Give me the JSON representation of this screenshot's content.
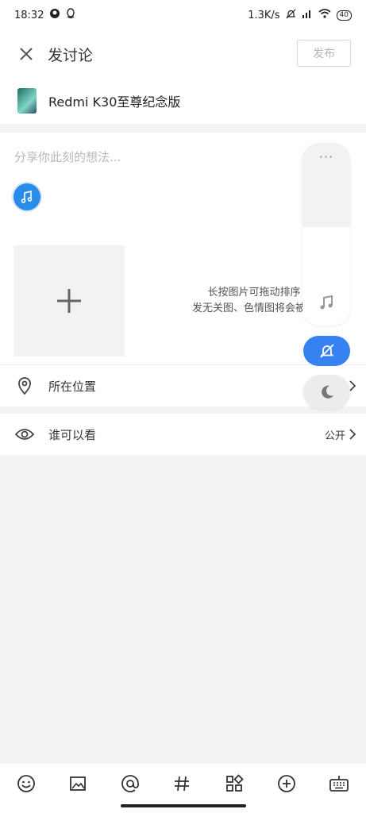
{
  "status_bar": {
    "time": "18:32",
    "network_speed": "1.3K/s",
    "battery": "40"
  },
  "header": {
    "title": "发讨论",
    "publish_label": "发布"
  },
  "device": {
    "name": "Redmi K30至尊纪念版"
  },
  "compose": {
    "placeholder": "分享你此刻的想法...",
    "hint_line1": "长按图片可拖动排序",
    "hint_line2": "发无关图、色情图将会被禁"
  },
  "location": {
    "label": "所在位置"
  },
  "visibility": {
    "label": "谁可以看",
    "value": "公开"
  },
  "overlay": {
    "dots": "···"
  },
  "colors": {
    "accent": "#3582f0",
    "music_chip": "#2b8bea"
  },
  "toolbar_icons": [
    "emoji-icon",
    "image-icon",
    "at-icon",
    "hashtag-icon",
    "apps-icon",
    "add-circle-icon",
    "keyboard-icon"
  ]
}
